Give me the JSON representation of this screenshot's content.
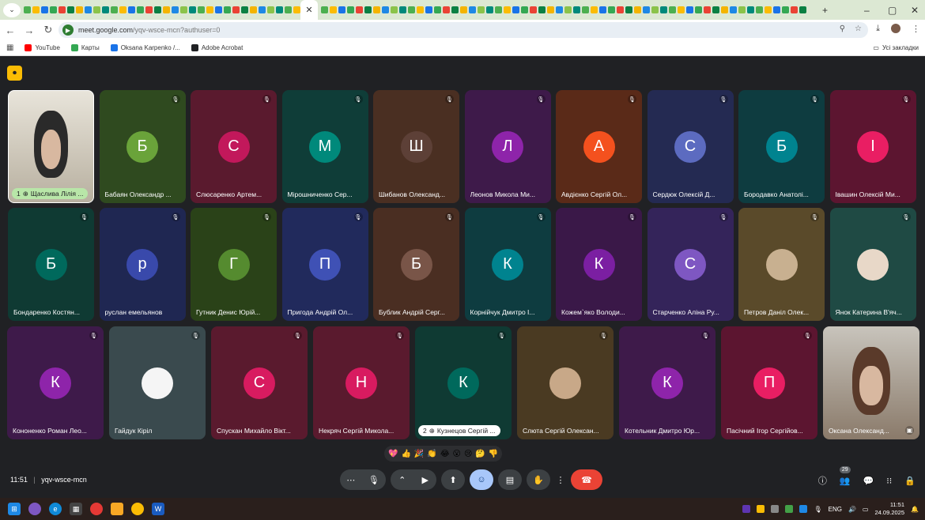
{
  "browser": {
    "url_host": "meet.google.com",
    "url_path": "/yqv-wsce-mcn?authuser=0",
    "window_controls": [
      "–",
      "▢",
      "✕"
    ],
    "bookmarks": [
      {
        "label": "YouTube",
        "color": "#ff0000"
      },
      {
        "label": "Карты",
        "color": "#34a853"
      },
      {
        "label": "Oksana Karpenko /...",
        "color": "#1a73e8"
      },
      {
        "label": "Adobe Acrobat",
        "color": "#202124"
      }
    ],
    "all_bookmarks_label": "Усі закладки"
  },
  "meet": {
    "participants_row1": [
      {
        "name": "Щаслива Лілія ...",
        "prefix": "1",
        "type": "video",
        "pill": "green"
      },
      {
        "name": "Бабаян Олександр ...",
        "initial": "Б",
        "color": "#6aa33a",
        "bg": "#2f4a1f"
      },
      {
        "name": "Слюсаренко Артем...",
        "initial": "С",
        "color": "#c2185b",
        "bg": "#5a1a2e"
      },
      {
        "name": "Мірошниченко Сер...",
        "initial": "М",
        "color": "#00897b",
        "bg": "#0f3d38"
      },
      {
        "name": "Шибанов Олександ...",
        "initial": "Ш",
        "color": "#5d4037",
        "bg": "#4a2f22"
      },
      {
        "name": "Леонов Микола Ми...",
        "initial": "Л",
        "color": "#8e24aa",
        "bg": "#3e1a4a"
      },
      {
        "name": "Авдієнко Сергій Ол...",
        "initial": "А",
        "color": "#f4511e",
        "bg": "#5a2a18"
      },
      {
        "name": "Сердюк Олексій Д...",
        "initial": "С",
        "color": "#5c6bc0",
        "bg": "#242a52"
      },
      {
        "name": "Бородавко Анатолі...",
        "initial": "Б",
        "color": "#00838f",
        "bg": "#0e3c40"
      },
      {
        "name": "Івашин Олексій Ми...",
        "initial": "І",
        "color": "#e91e63",
        "bg": "#5c1530"
      }
    ],
    "participants_row2": [
      {
        "name": "Бондаренко Костян...",
        "initial": "Б",
        "color": "#00695c",
        "bg": "#0f3a33"
      },
      {
        "name": "руслан емельянов",
        "initial": "р",
        "color": "#3949ab",
        "bg": "#1f2752"
      },
      {
        "name": "Гутник Денис Юрій...",
        "initial": "Г",
        "color": "#558b2f",
        "bg": "#2a4218"
      },
      {
        "name": "Пригода Андрій Ол...",
        "initial": "П",
        "color": "#3f51b5",
        "bg": "#212a5c"
      },
      {
        "name": "Бублик Андрій Серг...",
        "initial": "Б",
        "color": "#795548",
        "bg": "#4a2e22"
      },
      {
        "name": "Корнійчук Дмитро І...",
        "initial": "К",
        "color": "#00838f",
        "bg": "#0e3c40"
      },
      {
        "name": "Кожем`яко Володи...",
        "initial": "К",
        "color": "#7b1fa2",
        "bg": "#3a1848"
      },
      {
        "name": "Старченко Аліна Ру...",
        "initial": "С",
        "color": "#7e57c2",
        "bg": "#34245a"
      },
      {
        "name": "Петров Даніл Олек...",
        "type": "photo",
        "bg": "#5a4a2a",
        "photo": "#c8b090"
      },
      {
        "name": "Янок Катерина В'яч...",
        "type": "photo",
        "bg": "#1f4a44",
        "photo": "#e8d8c8"
      }
    ],
    "participants_row3": [
      {
        "name": "Кононенко Роман Лео...",
        "initial": "К",
        "color": "#8e24aa",
        "bg": "#3e1a4a"
      },
      {
        "name": "Гайдук Кіріл",
        "type": "photo",
        "bg": "#3a4a4e",
        "photo": "#f5f5f5"
      },
      {
        "name": "Спускан Михайло Вікт...",
        "initial": "С",
        "color": "#d81b60",
        "bg": "#5a1a2e"
      },
      {
        "name": "Некряч Сергій Микола...",
        "initial": "Н",
        "color": "#d81b60",
        "bg": "#5a1a2e"
      },
      {
        "name": "Кузнецов Сергій ...",
        "prefix": "2",
        "initial": "К",
        "color": "#00695c",
        "bg": "#0f3a33",
        "pill": "white"
      },
      {
        "name": "Слюта Сергій Олексан...",
        "type": "photo",
        "bg": "#4a3a22",
        "photo": "#c8a888"
      },
      {
        "name": "Котельник Дмитро Юр...",
        "initial": "К",
        "color": "#8e24aa",
        "bg": "#3e1a4a"
      },
      {
        "name": "Пасічний Ігор Сергійов...",
        "initial": "П",
        "color": "#e91e63",
        "bg": "#5c1530"
      },
      {
        "name": "Оксана Олександ...",
        "type": "video",
        "self": true
      }
    ],
    "reactions": [
      "💖",
      "👍",
      "🎉",
      "👏",
      "😂",
      "😮",
      "😢",
      "🤔",
      "👎"
    ],
    "time": "11:51",
    "meeting_code": "yqv-wsce-mcn",
    "participant_count": "29"
  },
  "taskbar": {
    "lang": "ENG",
    "time": "11:51",
    "date": "24.09.2025"
  }
}
